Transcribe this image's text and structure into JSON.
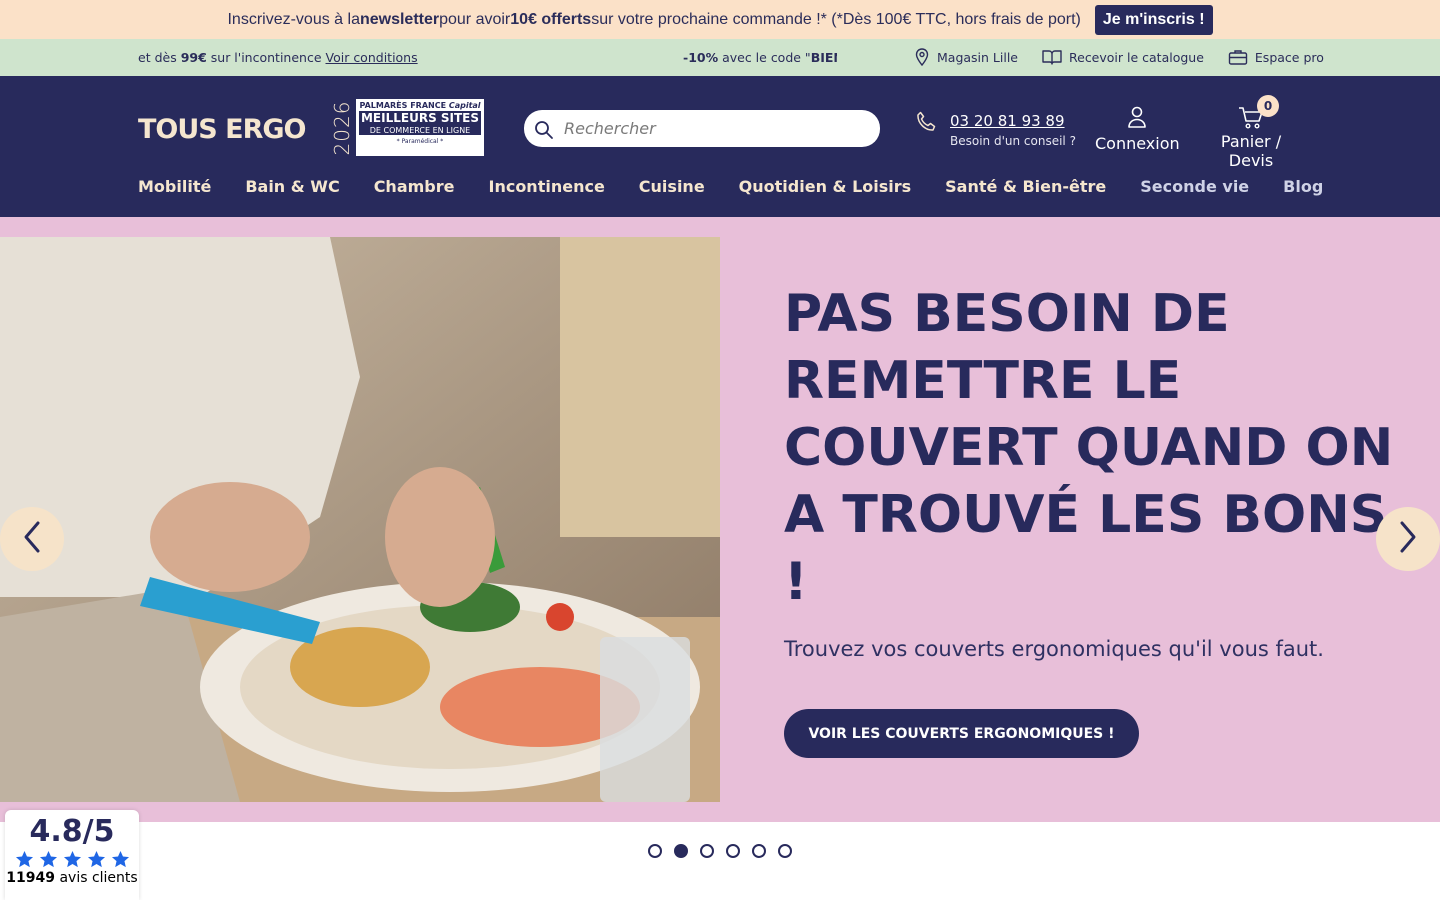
{
  "newsletter": {
    "prefix": "Inscrivez-vous à la ",
    "bold1": "newsletter",
    "middle": " pour avoir ",
    "bold2": "10€ offerts",
    "suffix": " sur votre prochaine commande !* (*Dès 100€ TTC, hors frais de port)",
    "cta": "Je m'inscris !"
  },
  "promo": {
    "left_prefix": "et dès ",
    "left_amount": "99€",
    "left_suffix": " sur l'incontinence ",
    "left_link": "Voir conditions",
    "center_bold": "-10%",
    "center_text": " avec le code \"",
    "center_code": "BIENVENUE",
    "links": [
      {
        "label": "Magasin Lille",
        "icon": "location-pin-icon"
      },
      {
        "label": "Recevoir le catalogue",
        "icon": "book-icon"
      },
      {
        "label": "Espace pro",
        "icon": "briefcase-icon"
      }
    ]
  },
  "header": {
    "logo": "TOUS ERGO",
    "award": {
      "year": "2026",
      "line1": "PALMARÈS FRANCE",
      "brand": "Capital",
      "line2": "MEILLEURS SITES",
      "line3": "DE COMMERCE EN LIGNE",
      "line4": "* Paramédical *"
    },
    "search_placeholder": "Rechercher",
    "phone": "03 20 81 93 89",
    "phone_hint": "Besoin d'un conseil ?",
    "account": "Connexion",
    "cart": "Panier / Devis",
    "cart_count": "0"
  },
  "nav": [
    "Mobilité",
    "Bain & WC",
    "Chambre",
    "Incontinence",
    "Cuisine",
    "Quotidien & Loisirs",
    "Santé & Bien-être",
    "Seconde vie",
    "Blog"
  ],
  "hero": {
    "title": "PAS BESOIN DE REMETTRE LE COUVERT QUAND ON A TROUVÉ LES BONS !",
    "subtitle": "Trouvez vos couverts ergonomiques qu'il vous faut.",
    "button": "VOIR LES COUVERTS ERGONOMIQUES !",
    "slides_total": 6,
    "active_slide": 2
  },
  "rating": {
    "score": "4.8/5",
    "count": "11949",
    "label": " avis clients",
    "stars": 5
  },
  "colors": {
    "navy": "#282a5c",
    "peach": "#fbe1c8",
    "mint": "#cfe4cd",
    "pink": "#e8bfd9",
    "star_blue": "#1f66e5"
  }
}
